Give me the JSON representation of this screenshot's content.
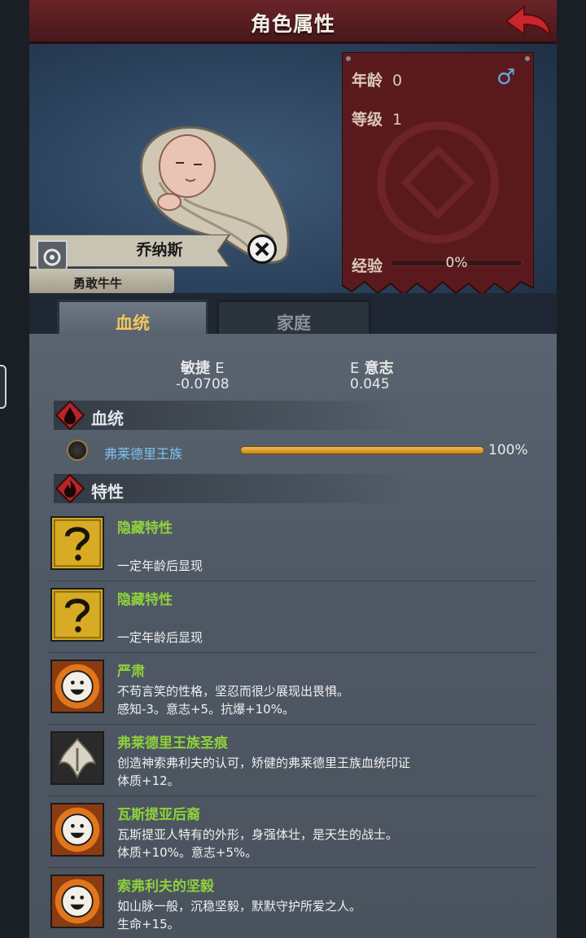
{
  "header": {
    "title": "角色属性"
  },
  "character": {
    "name": "乔纳斯",
    "title": "勇敢牛牛",
    "age_label": "年龄",
    "age": "0",
    "gender_symbol": "♂",
    "level_label": "等级",
    "level": "1",
    "exp_label": "经验",
    "exp_text": "0%",
    "exp_progress": 0
  },
  "tabs": [
    {
      "label": "血统",
      "active": true
    },
    {
      "label": "家庭",
      "active": false
    }
  ],
  "attributes": {
    "left": {
      "name": "敏捷",
      "grade": "E",
      "value": "-0.0708"
    },
    "right": {
      "name": "意志",
      "grade": "E",
      "value": "0.045"
    }
  },
  "bloodline_section": {
    "label": "血统",
    "name": "弗莱德里王族",
    "percent_text": "100%",
    "percent": 100
  },
  "traits_section": {
    "label": "特性"
  },
  "traits": [
    {
      "title": "隐藏特性",
      "lines": [
        "",
        "一定年龄后显现"
      ],
      "icon": "question-icon"
    },
    {
      "title": "隐藏特性",
      "lines": [
        "",
        "一定年龄后显现"
      ],
      "icon": "question-icon"
    },
    {
      "title": "严肃",
      "lines": [
        "不苟言笑的性格，坚忍而很少展现出畏惧。",
        "感知-3。意志+5。抗爆+10%。"
      ],
      "icon": "smiley-icon"
    },
    {
      "title": "弗莱德里王族圣痕",
      "lines": [
        "创造神索弗利夫的认可，矫健的弗莱德里王族血统印证",
        "体质+12。"
      ],
      "icon": "stigmata-icon"
    },
    {
      "title": "瓦斯提亚后裔",
      "lines": [
        "瓦斯提亚人特有的外形，身强体壮，是天生的战士。",
        "体质+10%。意志+5%。"
      ],
      "icon": "smiley-icon"
    },
    {
      "title": "索弗利夫的坚毅",
      "lines": [
        "如山脉一般，沉稳坚毅，默默守护所爱之人。",
        "生命+15。"
      ],
      "icon": "smiley-icon"
    }
  ],
  "colors": {
    "header_red": "#6a2428",
    "tab_active_text": "#f2c65a",
    "trait_title": "#8fd13a",
    "bloodline_name": "#7ec2f0",
    "bar_gold": "#f2bd4a"
  }
}
